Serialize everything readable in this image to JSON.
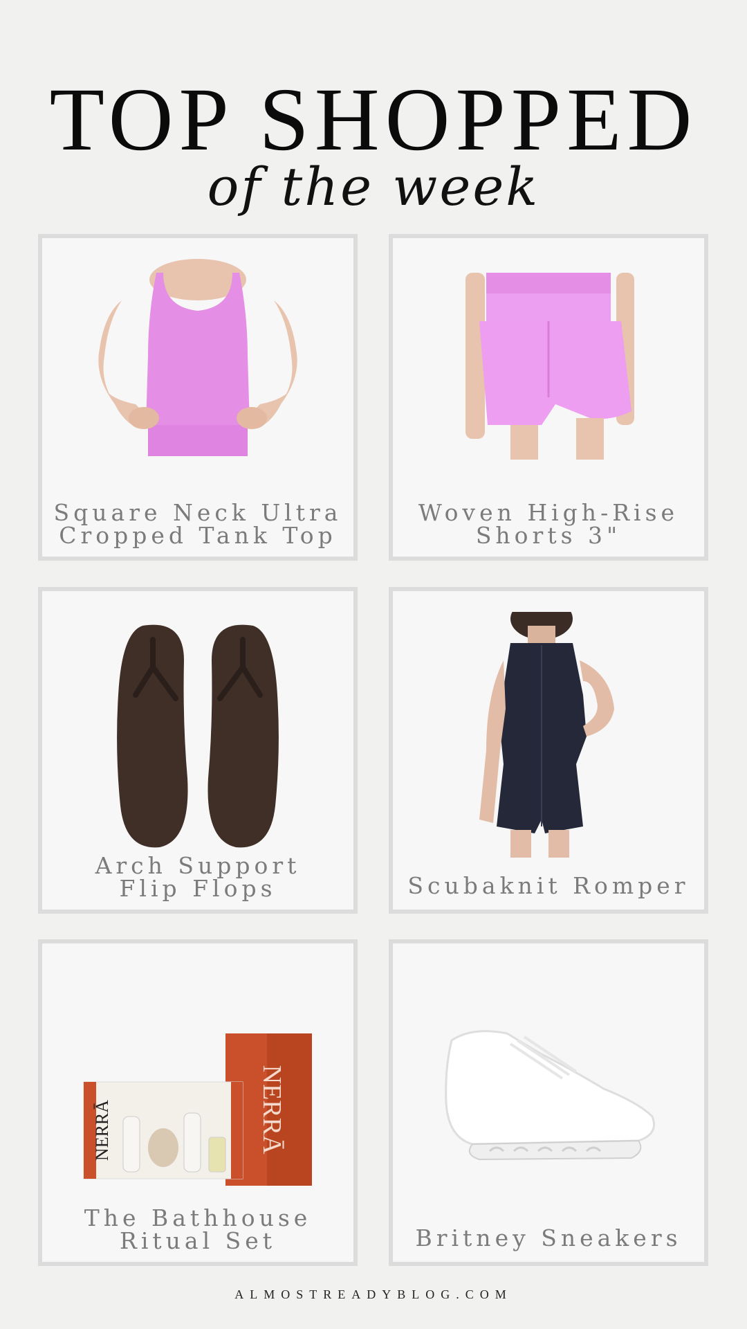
{
  "header": {
    "title": "TOP SHOPPED",
    "subtitle": "of the week"
  },
  "products": [
    {
      "label_line1": "Square Neck Ultra",
      "label_line2": "Cropped Tank Top",
      "icon": "pink-tank-top-image"
    },
    {
      "label_line1": "Woven High-Rise",
      "label_line2": "Shorts 3\"",
      "icon": "pink-shorts-image"
    },
    {
      "label_line1": "Arch Support",
      "label_line2": "Flip Flops",
      "icon": "brown-flip-flops-image"
    },
    {
      "label_line1": "Scubaknit Romper",
      "icon": "navy-romper-image"
    },
    {
      "label_line1": "The Bathhouse",
      "label_line2": "Ritual Set",
      "icon": "bathhouse-ritual-set-image",
      "brand_text": "NERRĀ"
    },
    {
      "label_line1": "Britney Sneakers",
      "icon": "white-sneakers-image"
    }
  ],
  "footer": {
    "text": "ALMOSTREADYBLOG.COM"
  },
  "colors": {
    "background": "#f1f1f0",
    "card_border": "#dcdcdc",
    "label_text": "#7b7b7b",
    "pink": "#e58ee6",
    "brown": "#3f2f27",
    "navy": "#252838",
    "orange": "#c9502a"
  }
}
